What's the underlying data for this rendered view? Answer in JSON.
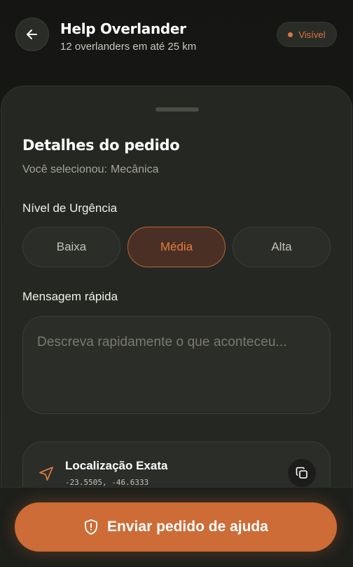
{
  "header": {
    "title": "Help Overlander",
    "subtitle": "12 overlanders em até 25 km",
    "visibility_label": "Visível",
    "back_icon": "arrow-left-icon"
  },
  "sheet": {
    "title": "Detalhes do pedido",
    "selected_prefix": "Você selecionou:",
    "selected_value": "Mecânica",
    "urgency": {
      "label": "Nível de Urgência",
      "options": [
        "Baixa",
        "Média",
        "Alta"
      ],
      "selected": "Média"
    },
    "message": {
      "label": "Mensagem rápida",
      "placeholder": "Descreva rapidamente o que aconteceu..."
    },
    "location": {
      "title": "Localização Exata",
      "coords": "-23.5505, -46.6333",
      "icon": "navigation-arrow-icon",
      "copy_icon": "copy-icon"
    }
  },
  "footer": {
    "send_label": "Enviar pedido de ajuda",
    "send_icon": "shield-alert-icon"
  },
  "colors": {
    "accent": "#cd6c36",
    "accent_text": "#e57b3d",
    "background": "#1a1b17",
    "card": "#2b2d28"
  }
}
